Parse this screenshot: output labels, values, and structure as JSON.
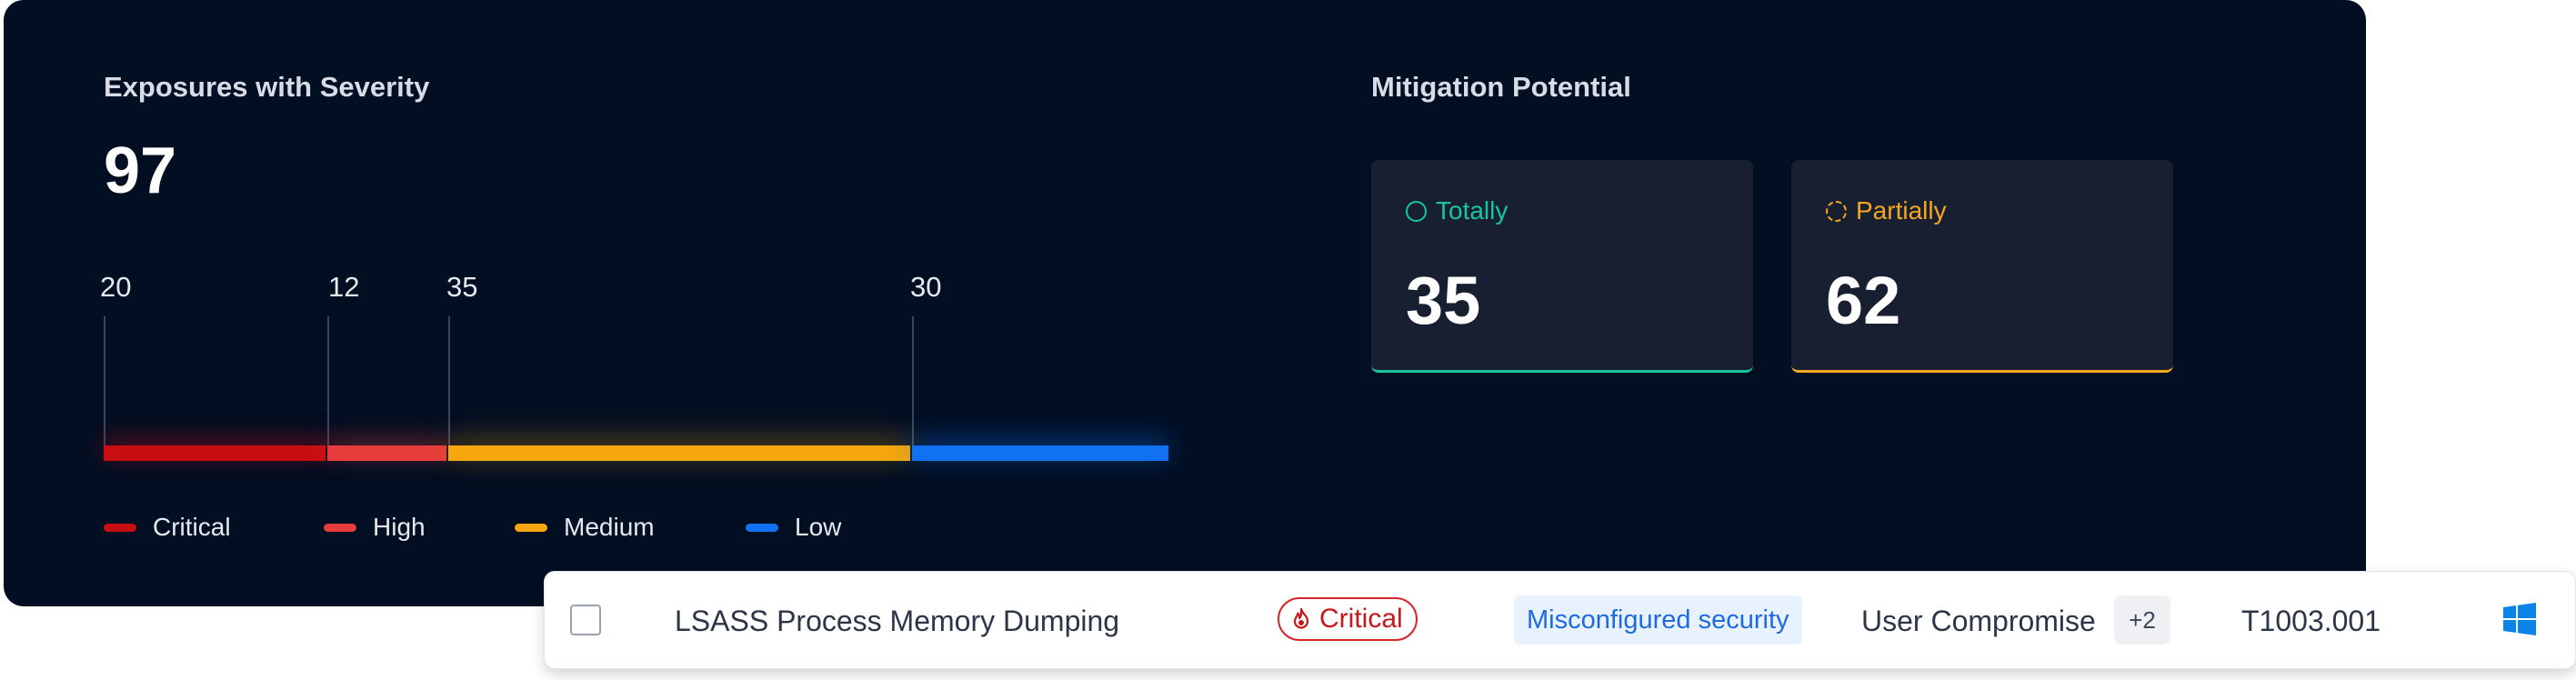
{
  "exposures": {
    "title": "Exposures with Severity",
    "total": "97",
    "segments": [
      {
        "name": "Critical",
        "count": "20",
        "color": "#c90e12"
      },
      {
        "name": "High",
        "count": "12",
        "color": "#e63c3c"
      },
      {
        "name": "Medium",
        "count": "35",
        "color": "#f5a70d"
      },
      {
        "name": "Low",
        "count": "30",
        "color": "#1071f2"
      }
    ],
    "legend": {
      "critical_label": "Critical",
      "high_label": "High",
      "medium_label": "Medium",
      "low_label": "Low"
    }
  },
  "mitigation": {
    "title": "Mitigation Potential",
    "totally": {
      "label": "Totally",
      "value": "35",
      "color": "#19c49a",
      "icon": "circle-outline-icon"
    },
    "partially": {
      "label": "Partially",
      "value": "62",
      "color": "#f5a623",
      "icon": "dashed-circle-icon"
    }
  },
  "row": {
    "name": "LSASS Process Memory Dumping",
    "severity": "Critical",
    "severity_icon": "flame-icon",
    "category": "Misconfigured security",
    "impact": "User Compromise",
    "extra_count": "+2",
    "technique_id": "T1003.001",
    "platform_icon": "windows-icon"
  }
}
